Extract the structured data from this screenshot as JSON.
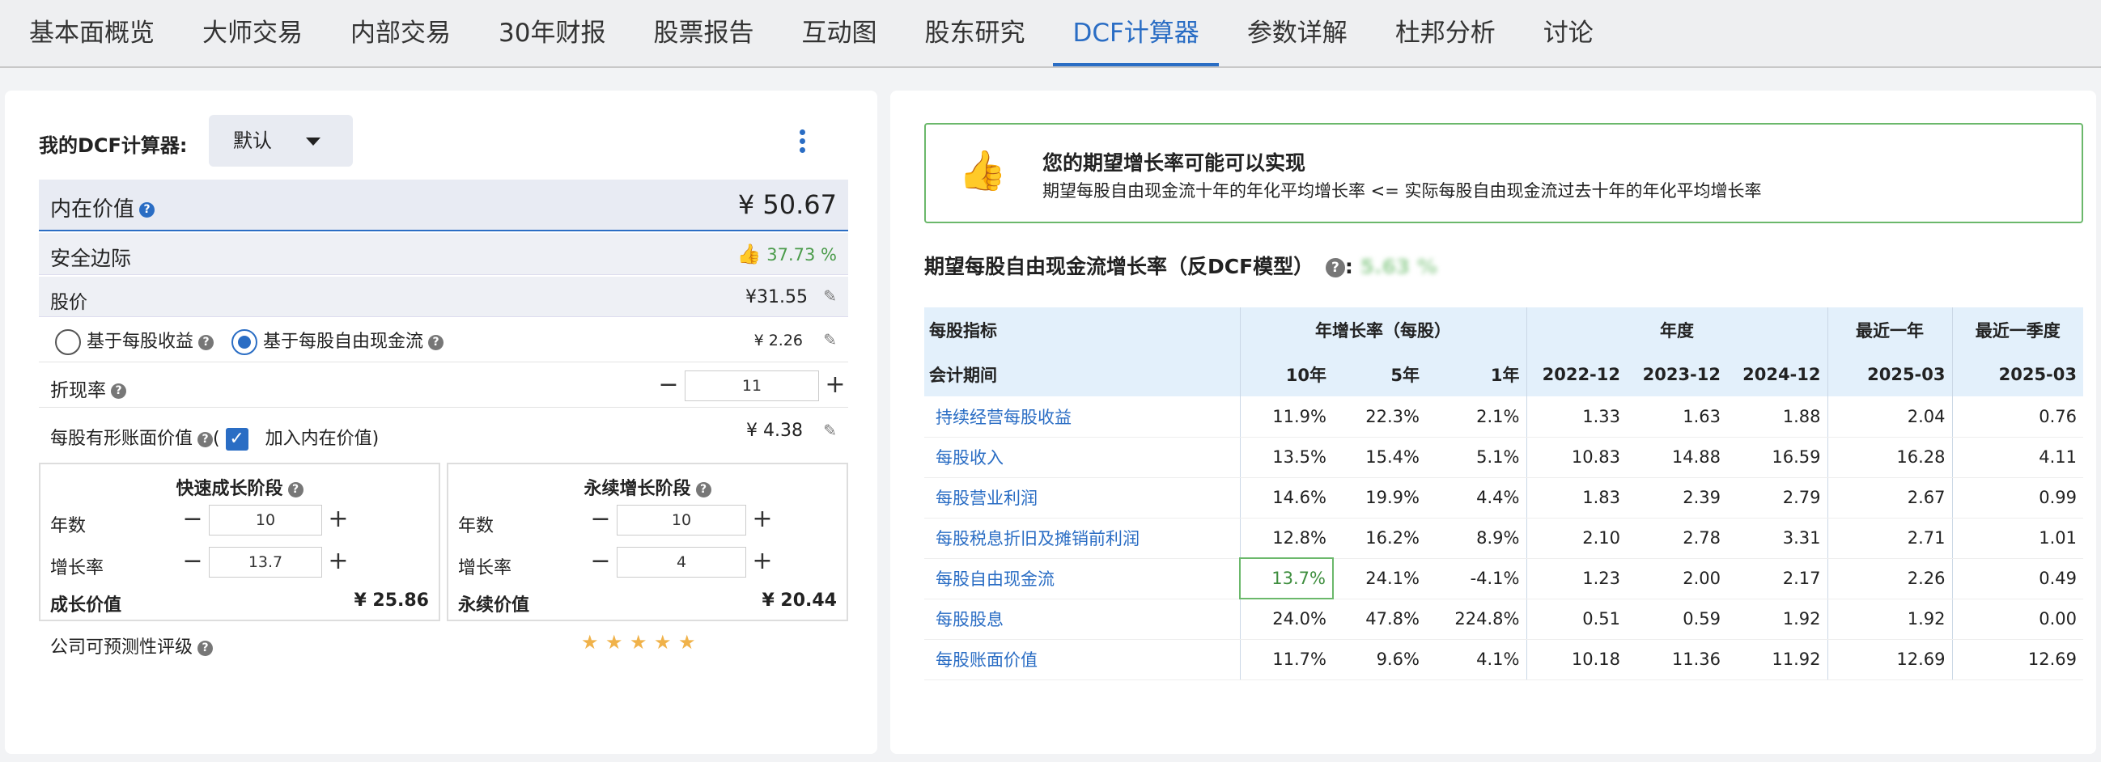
{
  "tabs": [
    "基本面概览",
    "大师交易",
    "内部交易",
    "30年财报",
    "股票报告",
    "互动图",
    "股东研究",
    "DCF计算器",
    "参数详解",
    "杜邦分析",
    "讨论"
  ],
  "active_tab": 7,
  "left": {
    "my_dcf_label": "我的DCF计算器:",
    "dropdown_value": "默认",
    "intrinsic": {
      "label": "内在价值",
      "value": "¥ 50.67"
    },
    "margin": {
      "label": "安全边际",
      "value": "37.73 %"
    },
    "price": {
      "label": "股价",
      "value": "¥31.55"
    },
    "radio_eps": "基于每股收益",
    "radio_fcf": "基于每股自由现金流",
    "fcf_value": "¥ 2.26",
    "discount": {
      "label": "折现率",
      "value": "11"
    },
    "tangible": {
      "label": "每股有形账面价值",
      "paren_open": "(",
      "checkbox_label": "加入内在价值)",
      "value": "¥ 4.38"
    },
    "fast": {
      "title": "快速成长阶段",
      "years_label": "年数",
      "years": "10",
      "growth_label": "增长率",
      "growth": "13.7",
      "value_label": "成长价值",
      "value": "¥ 25.86"
    },
    "term": {
      "title": "永续增长阶段",
      "years_label": "年数",
      "years": "10",
      "growth_label": "增长率",
      "growth": "4",
      "value_label": "永续价值",
      "value": "¥ 20.44"
    },
    "predictability": {
      "label": "公司可预测性评级",
      "stars": 5
    }
  },
  "right": {
    "banner_title": "您的期望增长率可能可以实现",
    "banner_desc": "期望每股自由现金流十年的年化平均增长率 <= 实际每股自由现金流过去十年的年化平均增长率",
    "section_title": "期望每股自由现金流增长率（反DCF模型）",
    "section_value": "5.63 %",
    "table": {
      "h1": [
        "每股指标",
        "年增长率（每股）",
        "年度",
        "最近一年",
        "最近一季度"
      ],
      "h2": [
        "会计期间",
        "10年",
        "5年",
        "1年",
        "2022-12",
        "2023-12",
        "2024-12",
        "2025-03",
        "2025-03"
      ],
      "rows": [
        [
          "持续经营每股收益",
          "11.9%",
          "22.3%",
          "2.1%",
          "1.33",
          "1.63",
          "1.88",
          "2.04",
          "0.76"
        ],
        [
          "每股收入",
          "13.5%",
          "15.4%",
          "5.1%",
          "10.83",
          "14.88",
          "16.59",
          "16.28",
          "4.11"
        ],
        [
          "每股营业利润",
          "14.6%",
          "19.9%",
          "4.4%",
          "1.83",
          "2.39",
          "2.79",
          "2.67",
          "0.99"
        ],
        [
          "每股税息折旧及摊销前利润",
          "12.8%",
          "16.2%",
          "8.9%",
          "2.10",
          "2.78",
          "3.31",
          "2.71",
          "1.01"
        ],
        [
          "每股自由现金流",
          "13.7%",
          "24.1%",
          "-4.1%",
          "1.23",
          "2.00",
          "2.17",
          "2.26",
          "0.49"
        ],
        [
          "每股股息",
          "24.0%",
          "47.8%",
          "224.8%",
          "0.51",
          "0.59",
          "1.92",
          "1.92",
          "0.00"
        ],
        [
          "每股账面价值",
          "11.7%",
          "9.6%",
          "4.1%",
          "10.18",
          "11.36",
          "11.92",
          "12.69",
          "12.69"
        ]
      ]
    }
  },
  "colors": {
    "accent": "#2a6dc4",
    "good": "#4a9b4a",
    "header_bg": "#e3f0fb",
    "star": "#f0b24a"
  }
}
